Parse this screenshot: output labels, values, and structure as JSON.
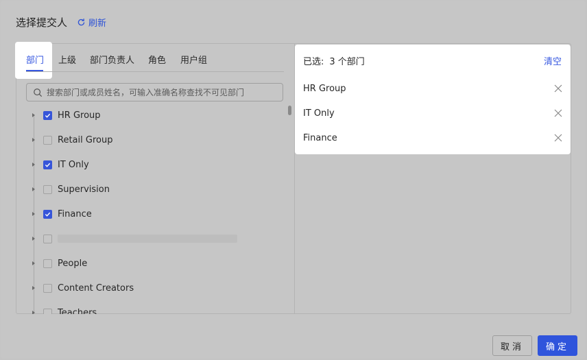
{
  "header": {
    "title": "选择提交人",
    "refresh_label": "刷新"
  },
  "tabs": [
    {
      "label": "部门",
      "active": true
    },
    {
      "label": "上级"
    },
    {
      "label": "部门负责人"
    },
    {
      "label": "角色"
    },
    {
      "label": "用户组"
    }
  ],
  "search": {
    "placeholder": "搜索部门或成员姓名，可输入准确名称查找不可见部门"
  },
  "tree": {
    "items": [
      {
        "label": "HR Group",
        "checked": true
      },
      {
        "label": "Retail Group",
        "checked": false
      },
      {
        "label": "IT Only",
        "checked": true
      },
      {
        "label": "Supervision",
        "checked": false
      },
      {
        "label": "Finance",
        "checked": true
      },
      {
        "label": "",
        "checked": false,
        "redacted": true
      },
      {
        "label": "People",
        "checked": false
      },
      {
        "label": "Content Creators",
        "checked": false
      },
      {
        "label": "Teachers",
        "checked": false
      }
    ]
  },
  "selected": {
    "prefix": "已选:",
    "count_text": "3 个部门",
    "clear_label": "清空",
    "items": [
      {
        "label": "HR Group"
      },
      {
        "label": "IT Only"
      },
      {
        "label": "Finance"
      }
    ]
  },
  "footer": {
    "cancel_label": "取消",
    "ok_label": "确定"
  },
  "colors": {
    "accent": "#3657e0",
    "ok_button": "#2f54dc",
    "overlay": "#c6c6c6"
  }
}
